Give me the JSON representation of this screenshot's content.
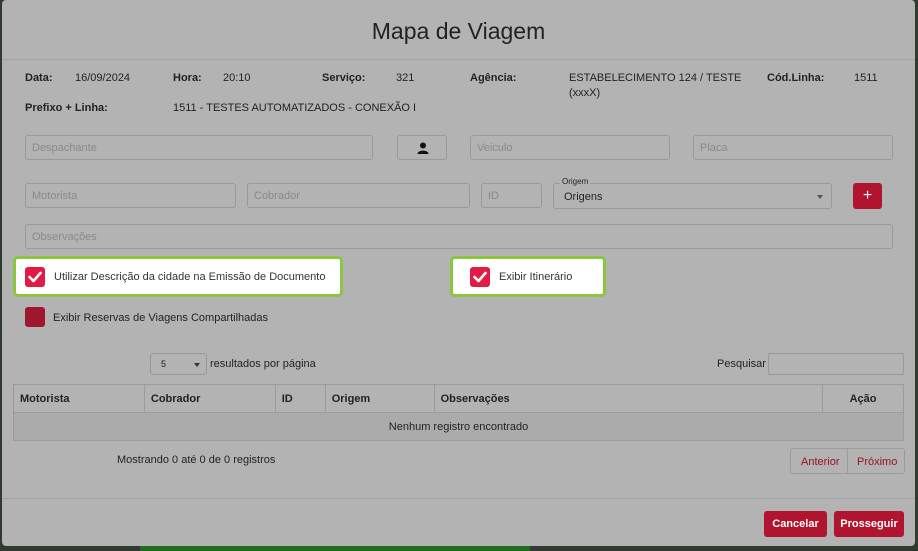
{
  "modal": {
    "title": "Mapa de Viagem"
  },
  "info": {
    "data_label": "Data:",
    "data_value": "16/09/2024",
    "hora_label": "Hora:",
    "hora_value": "20:10",
    "servico_label": "Serviço:",
    "servico_value": "321",
    "agencia_label": "Agência:",
    "agencia_value_line1": "ESTABELECIMENTO 124 / TESTE",
    "agencia_value_line2": "(xxxX)",
    "codlinha_label": "Cód.Linha:",
    "codlinha_value": "1511",
    "prefixo_label": "Prefixo + Linha:",
    "prefixo_value": "1511 - TESTES AUTOMATIZADOS - CONEXÃO I"
  },
  "form": {
    "despachante_placeholder": "Despachante",
    "veiculo_placeholder": "Veiculo",
    "placa_placeholder": "Placa",
    "motorista_placeholder": "Motorista",
    "cobrador_placeholder": "Cobrador",
    "id_placeholder": "ID",
    "origem_legend": "Origem",
    "origem_value": "Origens",
    "add_label": "+",
    "observacoes_placeholder": "Observações"
  },
  "options": {
    "descricao_cidade": {
      "label": "Utilizar Descrição da cidade na Emissão de Documento",
      "checked": true
    },
    "exibir_itinerario": {
      "label": "Exibir Itinerário",
      "checked": true
    },
    "reservas_compartilhadas": {
      "label": "Exibir Reservas de Viagens Compartilhadas",
      "checked": false
    }
  },
  "table": {
    "page_length": "5",
    "page_length_label": "resultados por página",
    "search_label": "Pesquisar",
    "columns": [
      "Motorista",
      "Cobrador",
      "ID",
      "Origem",
      "Observações",
      "Ação"
    ],
    "empty_message": "Nenhum registro encontrado",
    "info": "Mostrando 0 até 0 de 0 registros",
    "prev_label": "Anterior",
    "next_label": "Próximo"
  },
  "footer": {
    "cancel_label": "Cancelar",
    "proceed_label": "Prosseguir"
  },
  "colors": {
    "accent": "#e21b45",
    "highlight_border": "#8bc63f",
    "overlay": "#b3b3b3"
  }
}
